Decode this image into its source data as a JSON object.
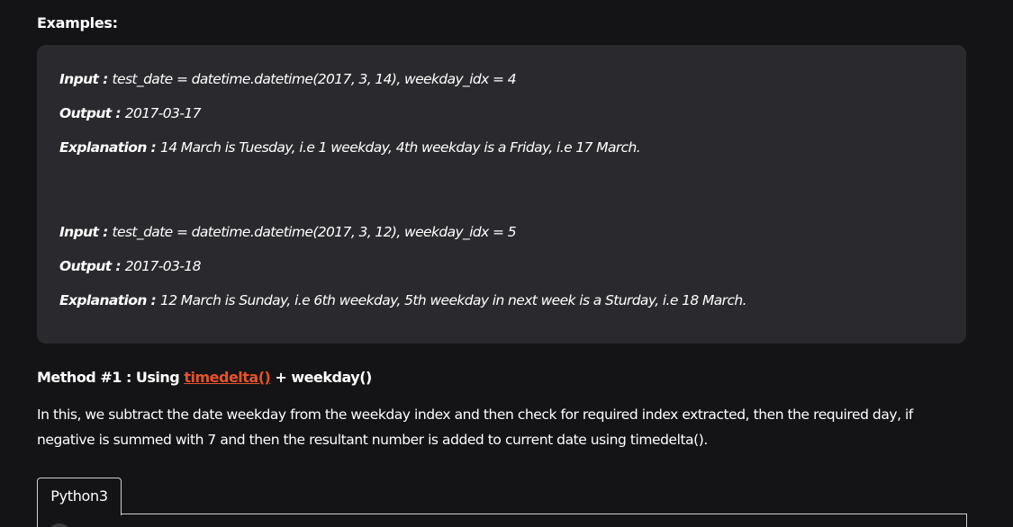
{
  "heading": "Examples:",
  "examples": [
    {
      "label": "Input : ",
      "text": "test_date = datetime.datetime(2017, 3, 14), weekday_idx = 4"
    },
    {
      "label": "Output : ",
      "text": "2017-03-17"
    },
    {
      "label": "Explanation : ",
      "text": "14 March is Tuesday, i.e 1 weekday, 4th weekday is a Friday, i.e 17 March."
    },
    {
      "label": "Input : ",
      "text": "test_date = datetime.datetime(2017, 3, 12), weekday_idx = 5"
    },
    {
      "label": "Output : ",
      "text": "2017-03-18"
    },
    {
      "label": "Explanation : ",
      "text": "12 March is Sunday, i.e 6th weekday, 5th weekday in next week is a Sturday, i.e 18 March."
    }
  ],
  "method": {
    "prefix": "Method #1 : Using ",
    "link_text": "timedelta()",
    "suffix": " + weekday()"
  },
  "description": "In this, we subtract the date weekday from the weekday index and then check for required index extracted, then the required day, if negative is summed with 7 and then the resultant number is added to current date using timedelta().",
  "code_tab": {
    "label": "Python3"
  },
  "colors": {
    "background": "#141416",
    "example_box": "#2a2a2e",
    "link": "#e5532b"
  }
}
